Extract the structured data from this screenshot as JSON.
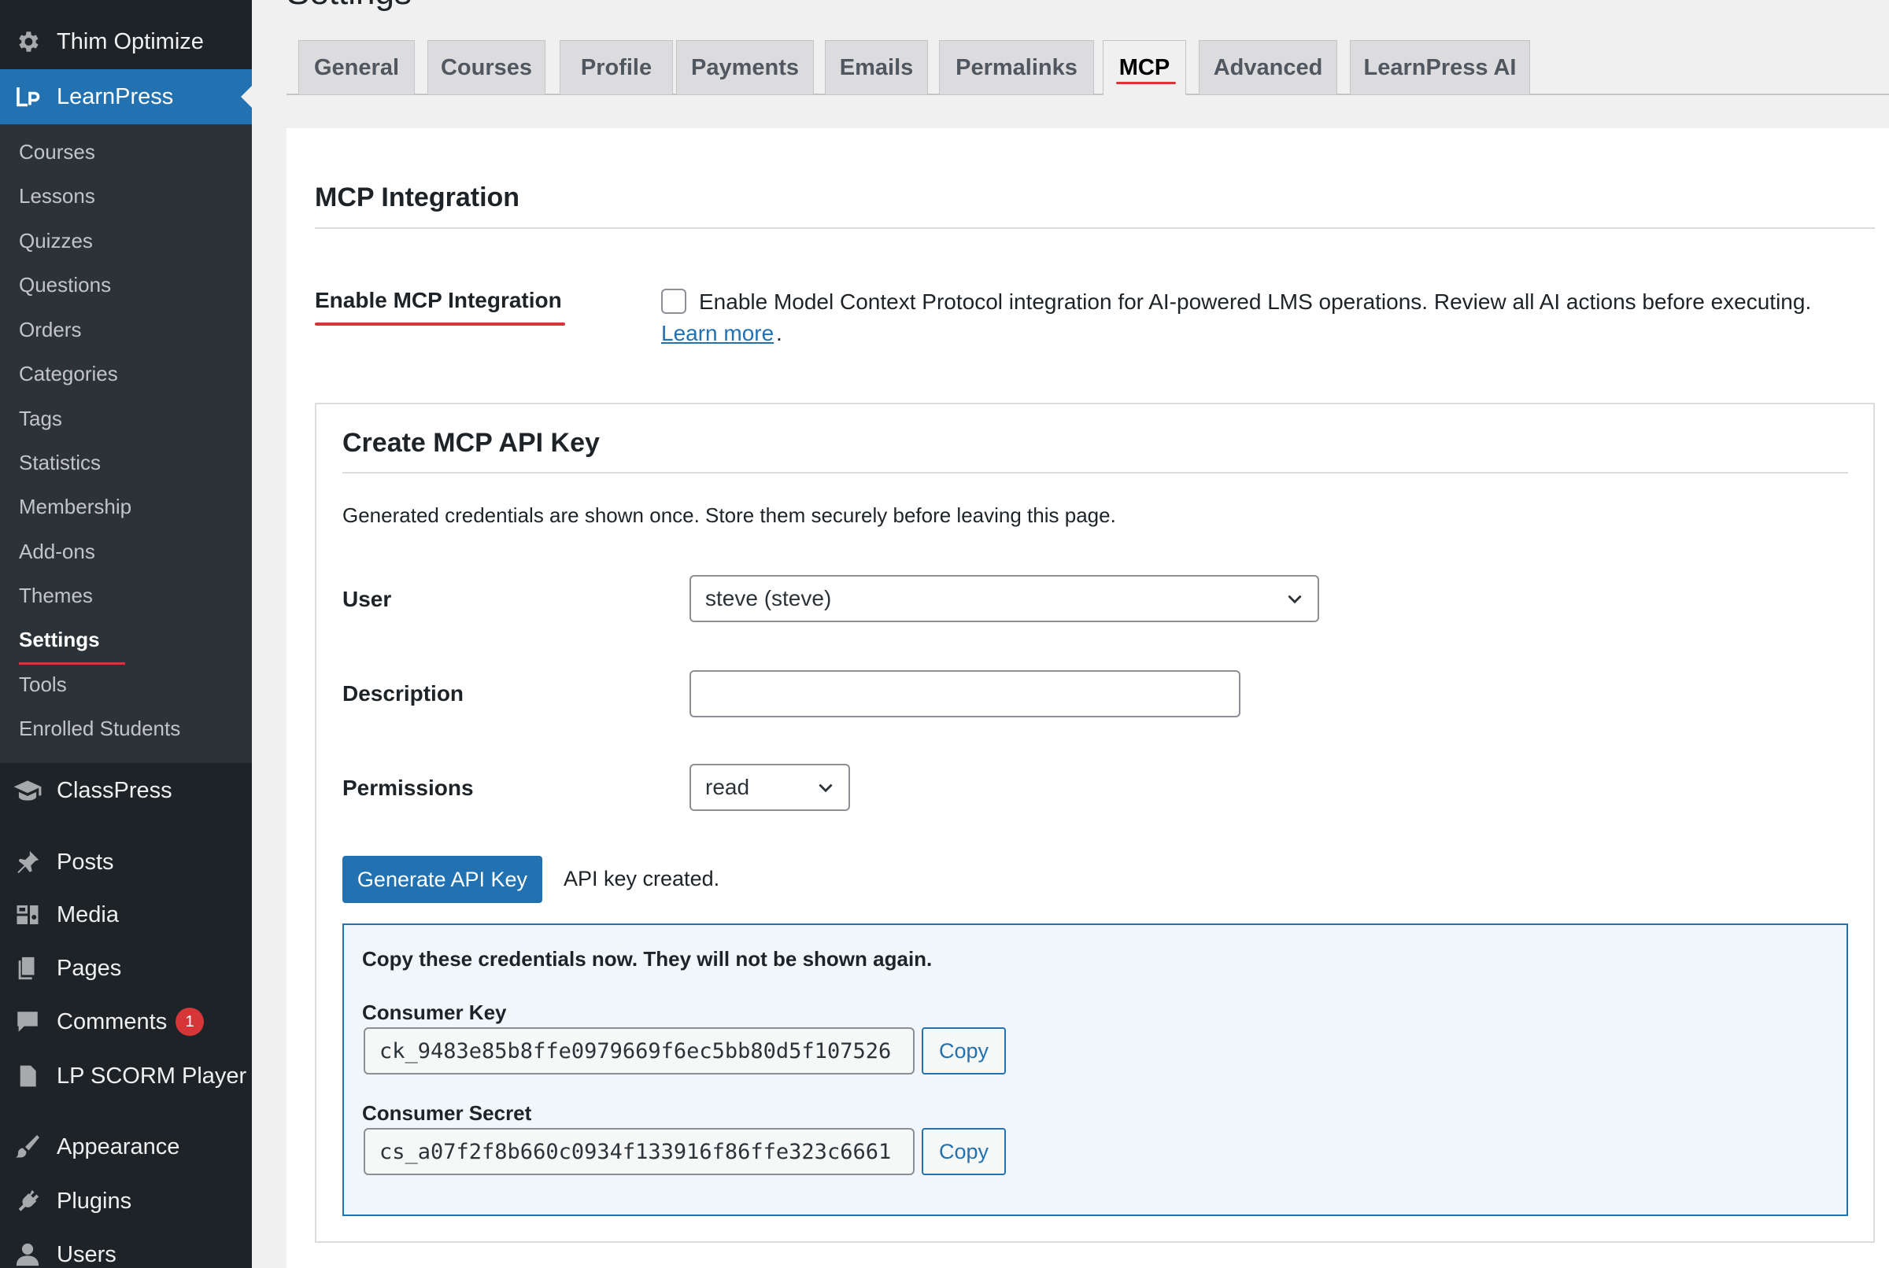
{
  "page": {
    "title": "Settings"
  },
  "sidebar": {
    "top_items": [
      {
        "label": "Thim Optimize",
        "icon": "gear-icon"
      },
      {
        "label": "LearnPress",
        "icon": "learnpress-icon"
      }
    ],
    "learnpress_submenu": [
      "Courses",
      "Lessons",
      "Quizzes",
      "Questions",
      "Orders",
      "Categories",
      "Tags",
      "Statistics",
      "Membership",
      "Add-ons",
      "Themes",
      "Settings",
      "Tools",
      "Enrolled Students"
    ],
    "current_submenu": "Settings",
    "bottom_items": [
      {
        "label": "ClassPress",
        "icon": "graduation-cap-icon"
      },
      {
        "label": "Posts",
        "icon": "pin-icon"
      },
      {
        "label": "Media",
        "icon": "media-icon"
      },
      {
        "label": "Pages",
        "icon": "pages-icon"
      },
      {
        "label": "Comments",
        "icon": "comment-icon",
        "badge": "1"
      },
      {
        "label": "LP SCORM Player",
        "icon": "document-icon"
      },
      {
        "label": "Appearance",
        "icon": "brush-icon"
      },
      {
        "label": "Plugins",
        "icon": "plug-icon"
      },
      {
        "label": "Users",
        "icon": "user-icon"
      }
    ]
  },
  "tabs": [
    "General",
    "Courses",
    "Profile",
    "Payments",
    "Emails",
    "Permalinks",
    "MCP",
    "Advanced",
    "LearnPress AI"
  ],
  "active_tab": "MCP",
  "section": {
    "title": "MCP Integration",
    "enable_label": "Enable MCP Integration",
    "enable_checked": false,
    "enable_description": "Enable Model Context Protocol integration for AI-powered LMS operations. Review all AI actions before executing.",
    "learn_more": "Learn more",
    "learn_more_suffix": "."
  },
  "api_key": {
    "title": "Create MCP API Key",
    "note": "Generated credentials are shown once. Store them securely before leaving this page.",
    "user_label": "User",
    "user_value": "steve (steve)",
    "description_label": "Description",
    "description_value": "",
    "permissions_label": "Permissions",
    "permissions_value": "read",
    "generate_button": "Generate API Key",
    "status": "API key created.",
    "credentials_note": "Copy these credentials now. They will not be shown again.",
    "consumer_key_label": "Consumer Key",
    "consumer_key_value": "ck_9483e85b8ffe0979669f6ec5bb80d5f107526",
    "consumer_secret_label": "Consumer Secret",
    "consumer_secret_value": "cs_a07f2f8b660c0934f133916f86ffe323c6661",
    "copy_label": "Copy"
  },
  "colors": {
    "accent": "#2271b1",
    "sidebar_bg": "#1d2327",
    "submenu_bg": "#2c3338",
    "highlight": "#d63638"
  }
}
